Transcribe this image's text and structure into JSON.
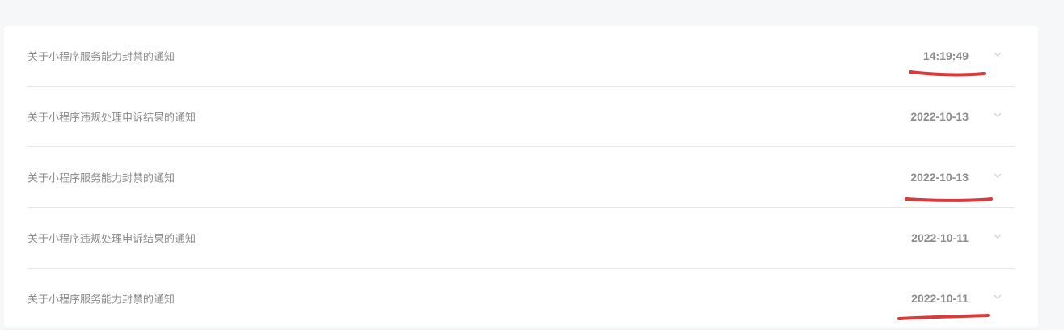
{
  "notices": [
    {
      "title": "关于小程序服务能力封禁的通知",
      "date": "14:19:49"
    },
    {
      "title": "关于小程序违规处理申诉结果的通知",
      "date": "2022-10-13"
    },
    {
      "title": "关于小程序服务能力封禁的通知",
      "date": "2022-10-13"
    },
    {
      "title": "关于小程序违规处理申诉结果的通知",
      "date": "2022-10-11"
    },
    {
      "title": "关于小程序服务能力封禁的通知",
      "date": "2022-10-11"
    }
  ],
  "icons": {
    "expand": "chevron-down-icon"
  },
  "colors": {
    "annotation": "#d93b3b",
    "text": "#8a8a8a",
    "divider": "#e6e6e6"
  }
}
